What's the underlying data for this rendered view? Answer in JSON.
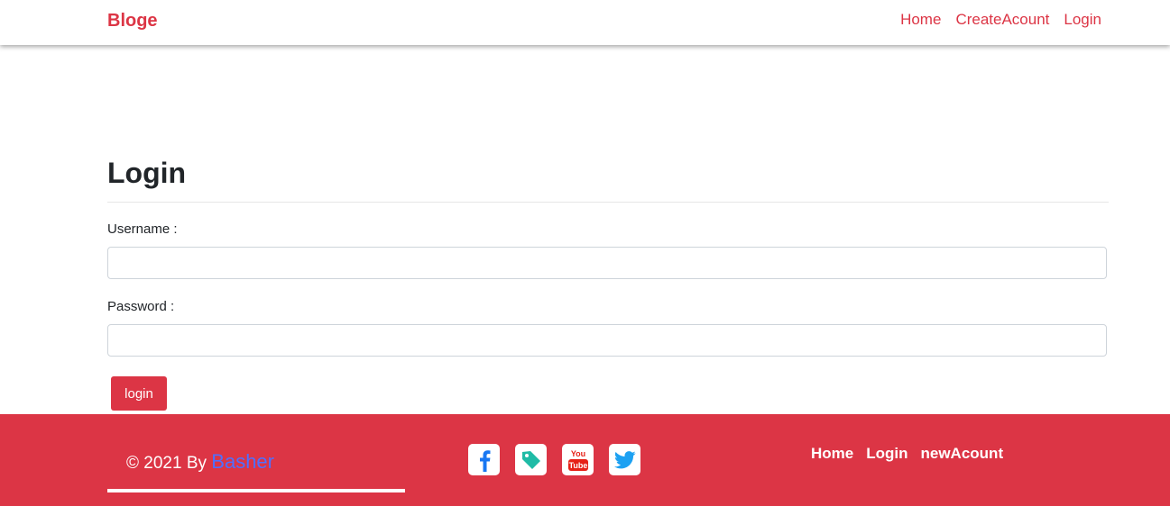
{
  "navbar": {
    "brand": "Bloge",
    "links": [
      "Home",
      "CreateAcount",
      "Login"
    ]
  },
  "form": {
    "title": "Login",
    "username_label": "Username :",
    "password_label": "Password :",
    "username_value": "",
    "password_value": "",
    "submit_label": "login"
  },
  "footer": {
    "copyright": "© 2021 By",
    "author": "Basher",
    "social_icons": [
      "facebook-icon",
      "tag-icon",
      "youtube-icon",
      "twitter-icon"
    ],
    "links": [
      "Home",
      "Login",
      "newAcount"
    ]
  },
  "colors": {
    "accent": "#dc3545",
    "author_link": "#4f6fff",
    "facebook": "#1877f2",
    "tag": "#1fbba6",
    "youtube": "#e62117",
    "twitter": "#1da1f2"
  }
}
